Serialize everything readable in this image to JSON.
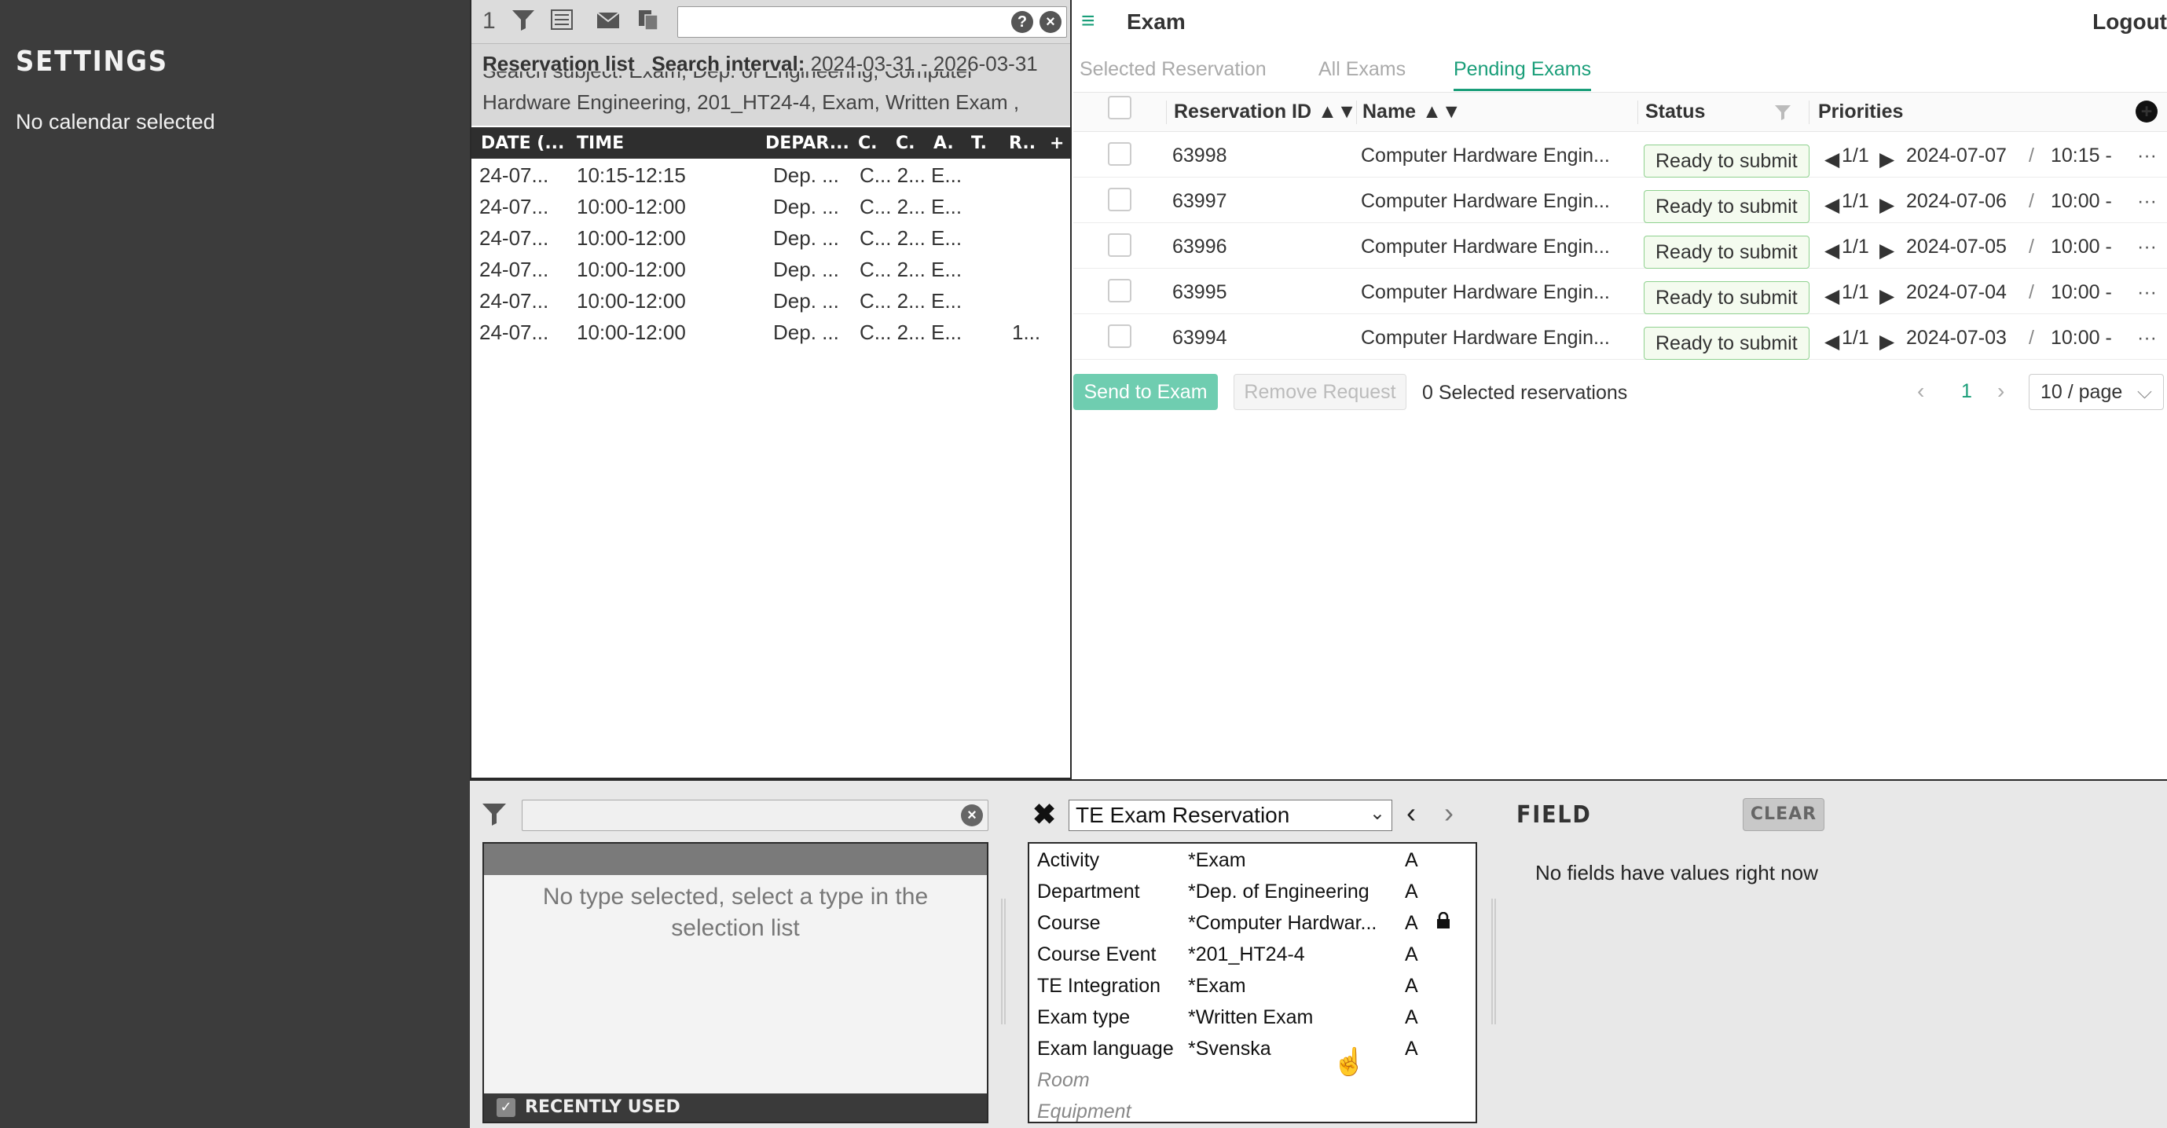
{
  "sidebar": {
    "title": "SETTINGS",
    "subtitle": "No calendar selected"
  },
  "reservation_list": {
    "toolbar": {
      "count": "1",
      "search_value": ""
    },
    "info": {
      "list_label": "Reservation list",
      "interval_label": "Search interval:",
      "interval_value": "2024-03-31 - 2026-03-31",
      "subject_line": "Search subject: Exam, Dep. of Engineering, Computer",
      "subject_line2": "Hardware Engineering, 201_HT24-4, Exam, Written Exam ,"
    },
    "columns": [
      "DATE (...",
      "TIME",
      "DEPAR...",
      "C.",
      "C.",
      "A.",
      "T.",
      "R..",
      "+"
    ],
    "rows": [
      {
        "date": "24-07...",
        "time": "10:15-12:15",
        "dep": "Dep. ...",
        "rest": "C... 2... E...",
        "r": ""
      },
      {
        "date": "24-07...",
        "time": "10:00-12:00",
        "dep": "Dep. ...",
        "rest": "C... 2... E...",
        "r": ""
      },
      {
        "date": "24-07...",
        "time": "10:00-12:00",
        "dep": "Dep. ...",
        "rest": "C... 2... E...",
        "r": ""
      },
      {
        "date": "24-07...",
        "time": "10:00-12:00",
        "dep": "Dep. ...",
        "rest": "C... 2... E...",
        "r": ""
      },
      {
        "date": "24-07...",
        "time": "10:00-12:00",
        "dep": "Dep. ...",
        "rest": "C... 2... E...",
        "r": ""
      },
      {
        "date": "24-07...",
        "time": "10:00-12:00",
        "dep": "Dep. ...",
        "rest": "C... 2... E...",
        "r": "1..."
      }
    ]
  },
  "exam": {
    "title": "Exam",
    "logout": "Logout",
    "tabs": [
      "Selected Reservation",
      "All Exams",
      "Pending Exams"
    ],
    "active_tab": "Pending Exams",
    "columns": {
      "reservation_id": "Reservation ID",
      "name": "Name",
      "status": "Status",
      "priorities": "Priorities"
    },
    "rows": [
      {
        "id": "63998",
        "name": "Computer Hardware Engin...",
        "status": "Ready to submit",
        "priority": "1/1",
        "date": "2024-07-07",
        "time": "10:15 -"
      },
      {
        "id": "63997",
        "name": "Computer Hardware Engin...",
        "status": "Ready to submit",
        "priority": "1/1",
        "date": "2024-07-06",
        "time": "10:00 -"
      },
      {
        "id": "63996",
        "name": "Computer Hardware Engin...",
        "status": "Ready to submit",
        "priority": "1/1",
        "date": "2024-07-05",
        "time": "10:00 -"
      },
      {
        "id": "63995",
        "name": "Computer Hardware Engin...",
        "status": "Ready to submit",
        "priority": "1/1",
        "date": "2024-07-04",
        "time": "10:00 -"
      },
      {
        "id": "63994",
        "name": "Computer Hardware Engin...",
        "status": "Ready to submit",
        "priority": "1/1",
        "date": "2024-07-03",
        "time": "10:00 -"
      }
    ],
    "actions": {
      "send": "Send to Exam",
      "remove": "Remove Request",
      "selected": "0 Selected reservations",
      "page": "1",
      "page_size": "10 / page"
    }
  },
  "bottom": {
    "type_search_value": "",
    "no_type_msg": "No type selected, select a type in the selection list",
    "recently_used": "RECENTLY USED",
    "reservation_type": "TE Exam Reservation",
    "fields": [
      {
        "label": "Activity",
        "value": "*Exam",
        "flag": "A",
        "locked": false
      },
      {
        "label": "Department",
        "value": "*Dep. of Engineering",
        "flag": "A",
        "locked": false
      },
      {
        "label": "Course",
        "value": "*Computer Hardwar...",
        "flag": "A",
        "locked": true
      },
      {
        "label": "Course Event",
        "value": "*201_HT24-4",
        "flag": "A",
        "locked": false
      },
      {
        "label": "TE Integration",
        "value": "*Exam",
        "flag": "A",
        "locked": false
      },
      {
        "label": "Exam type",
        "value": "*Written Exam",
        "flag": "A",
        "locked": false
      },
      {
        "label": "Exam language",
        "value": "*Svenska",
        "flag": "A",
        "locked": false
      },
      {
        "label": "Room",
        "value": "",
        "flag": "",
        "locked": false
      },
      {
        "label": "Equipment",
        "value": "",
        "flag": "",
        "locked": false
      }
    ],
    "field_title": "FIELD",
    "clear": "CLEAR",
    "no_fields": "No fields have values right now"
  },
  "colors": {
    "accent": "#1a9e79",
    "sidebar_bg": "#3c3c3c",
    "status_green": "#3aa53a"
  }
}
